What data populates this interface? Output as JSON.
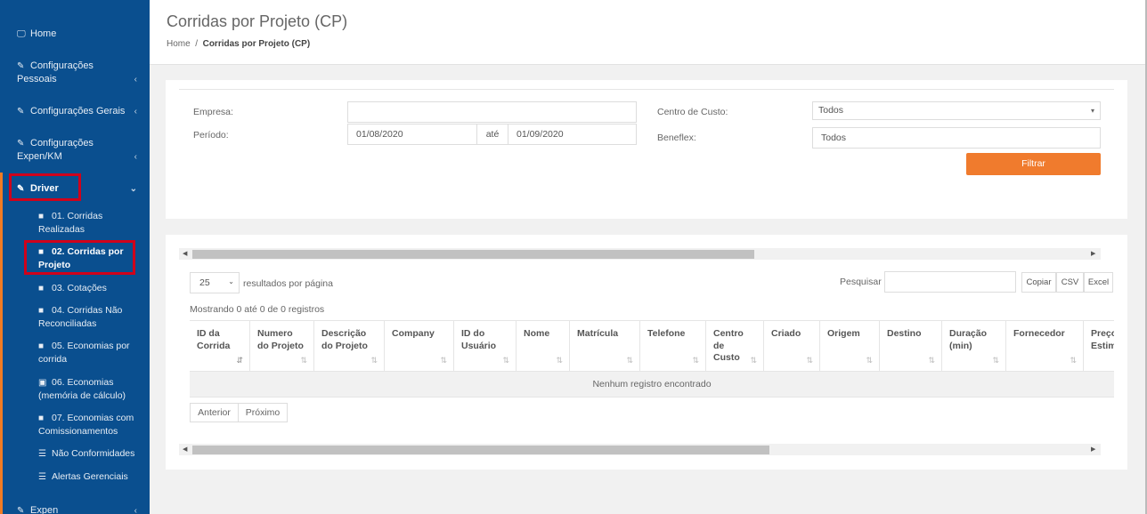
{
  "sidebar": {
    "items": [
      {
        "label": "Home",
        "icon": "laptop-icon"
      },
      {
        "label": "Configurações Pessoais",
        "icon": "edit-icon"
      },
      {
        "label": "Configurações Gerais",
        "icon": "edit-icon"
      },
      {
        "label": "Configurações Expen/KM",
        "icon": "edit-icon"
      },
      {
        "label": "Driver",
        "icon": "edit-icon"
      },
      {
        "label": "Expen",
        "icon": "edit-icon"
      }
    ],
    "driver_sub": [
      {
        "label": "01. Corridas Realizadas",
        "icon": "file-icon"
      },
      {
        "label": "02. Corridas por Projeto",
        "icon": "file-icon"
      },
      {
        "label": "03. Cotações",
        "icon": "file-icon"
      },
      {
        "label": "04. Corridas Não Reconciliadas",
        "icon": "file-icon"
      },
      {
        "label": "05. Economias por corrida",
        "icon": "file-icon"
      },
      {
        "label": "06. Economias (memória de cálculo)",
        "icon": "money-icon"
      },
      {
        "label": "07. Economias com Comissionamentos",
        "icon": "file-icon"
      },
      {
        "label": "Não Conformidades",
        "icon": "list-icon"
      },
      {
        "label": "Alertas Gerenciais",
        "icon": "list-icon"
      }
    ],
    "bg_color": "#0a4f8f",
    "accent_color": "#f07b23",
    "highlight_color": "#d0021b"
  },
  "header": {
    "title": "Corridas por Projeto (CP)",
    "breadcrumb_home": "Home",
    "breadcrumb_sep": "/",
    "breadcrumb_current": "Corridas por Projeto (CP)"
  },
  "filters": {
    "empresa_label": "Empresa:",
    "empresa_value": "",
    "periodo_label": "Período:",
    "periodo_start": "01/08/2020",
    "periodo_ate": "até",
    "periodo_end": "01/09/2020",
    "centro_label": "Centro de Custo:",
    "centro_value": "Todos",
    "beneflex_label": "Beneflex:",
    "beneflex_value": "Todos",
    "filtrar_label": "Filtrar"
  },
  "table": {
    "page_length": "25",
    "page_length_suffix": "resultados por página",
    "search_label": "Pesquisar",
    "search_value": "",
    "buttons": [
      "Copiar",
      "CSV",
      "Excel"
    ],
    "info": "Mostrando 0 até 0 de 0 registros",
    "columns": [
      "ID da Corrida",
      "Numero do Projeto",
      "Descrição do Projeto",
      "Company",
      "ID do Usuário",
      "Nome",
      "Matrícula",
      "Telefone",
      "Centro de Custo",
      "Criado",
      "Origem",
      "Destino",
      "Duração (min)",
      "Fornecedor",
      "Preço Estim"
    ],
    "empty_message": "Nenhum registro encontrado",
    "prev_label": "Anterior",
    "next_label": "Próximo"
  }
}
